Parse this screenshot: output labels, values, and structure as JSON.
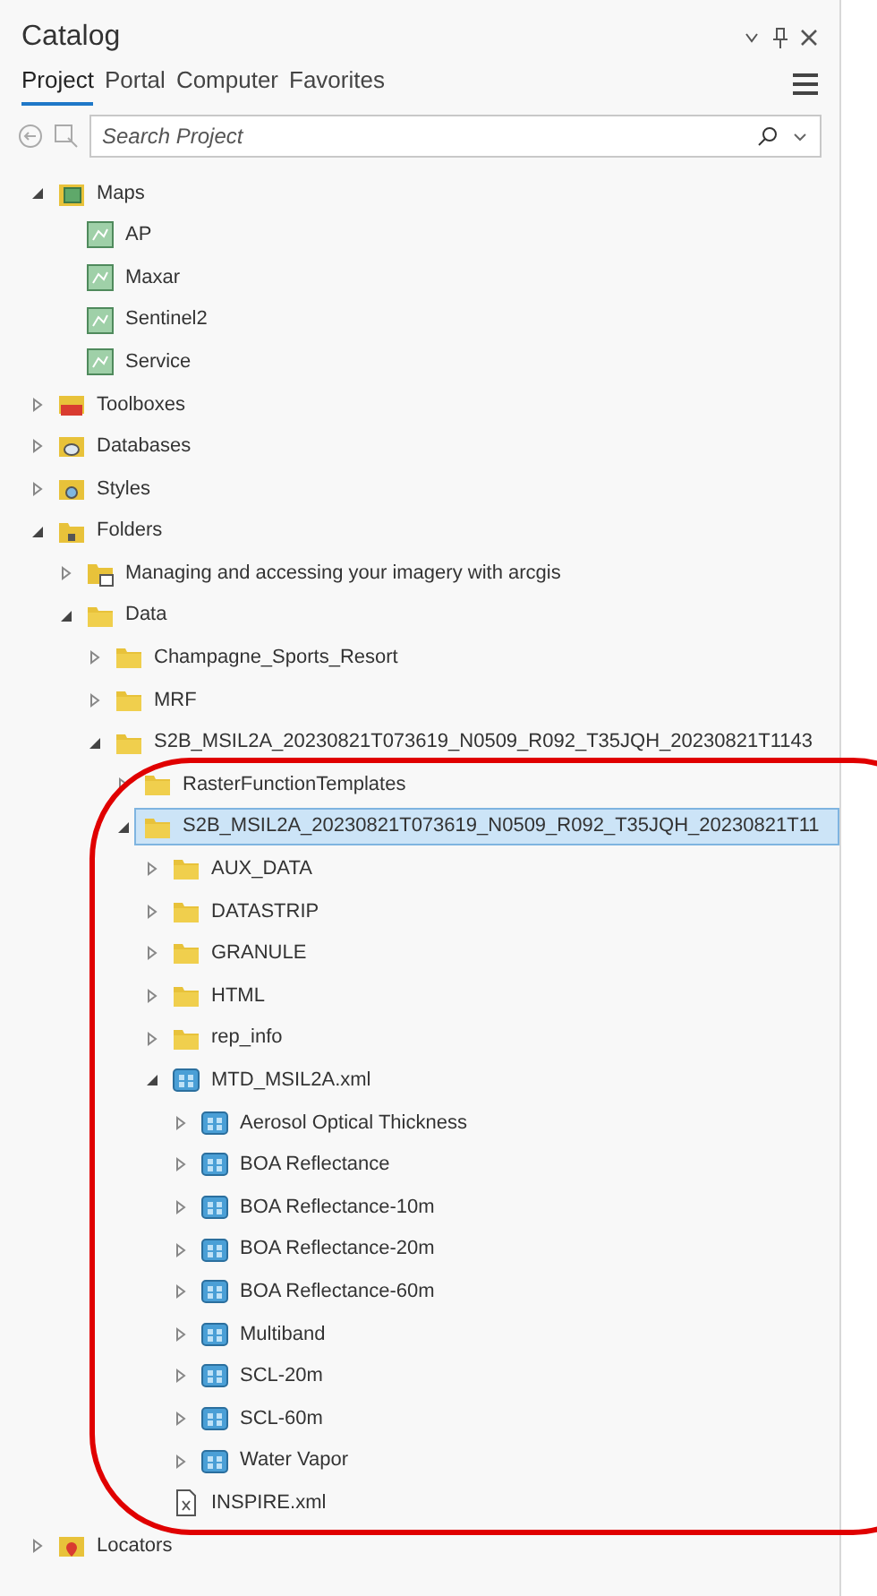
{
  "window": {
    "title": "Catalog"
  },
  "tabs": [
    {
      "label": "Project",
      "selected": true
    },
    {
      "label": "Portal",
      "selected": false
    },
    {
      "label": "Computer",
      "selected": false
    },
    {
      "label": "Favorites",
      "selected": false
    }
  ],
  "search": {
    "placeholder": "Search Project"
  },
  "tree": [
    {
      "label": "Maps",
      "kind": "maps",
      "expanded": true,
      "selected": false,
      "children": [
        {
          "label": "AP",
          "kind": "map",
          "selected": false
        },
        {
          "label": "Maxar",
          "kind": "map",
          "selected": false
        },
        {
          "label": "Sentinel2",
          "kind": "map",
          "selected": false
        },
        {
          "label": "Service",
          "kind": "map",
          "selected": false
        }
      ]
    },
    {
      "label": "Toolboxes",
      "kind": "toolboxes",
      "expanded": false,
      "selected": false
    },
    {
      "label": "Databases",
      "kind": "databases",
      "expanded": false,
      "selected": false
    },
    {
      "label": "Styles",
      "kind": "styles",
      "expanded": false,
      "selected": false
    },
    {
      "label": "Folders",
      "kind": "folders",
      "expanded": true,
      "selected": false,
      "children": [
        {
          "label": "Managing and accessing your imagery with arcgis",
          "kind": "folder-connection",
          "expanded": false,
          "selected": false
        },
        {
          "label": "Data",
          "kind": "folder",
          "expanded": true,
          "selected": false,
          "children": [
            {
              "label": "Champagne_Sports_Resort",
              "kind": "folder",
              "expanded": false,
              "selected": false
            },
            {
              "label": "MRF",
              "kind": "folder",
              "expanded": false,
              "selected": false
            },
            {
              "label": "S2B_MSIL2A_20230821T073619_N0509_R092_T35JQH_20230821T1143",
              "kind": "folder",
              "expanded": true,
              "selected": false,
              "children": [
                {
                  "label": "RasterFunctionTemplates",
                  "kind": "folder",
                  "expanded": false,
                  "selected": false
                },
                {
                  "label": "S2B_MSIL2A_20230821T073619_N0509_R092_T35JQH_20230821T11",
                  "kind": "folder",
                  "expanded": true,
                  "selected": true,
                  "children": [
                    {
                      "label": "AUX_DATA",
                      "kind": "folder",
                      "expanded": false,
                      "selected": false
                    },
                    {
                      "label": "DATASTRIP",
                      "kind": "folder",
                      "expanded": false,
                      "selected": false
                    },
                    {
                      "label": "GRANULE",
                      "kind": "folder",
                      "expanded": false,
                      "selected": false
                    },
                    {
                      "label": "HTML",
                      "kind": "folder",
                      "expanded": false,
                      "selected": false
                    },
                    {
                      "label": "rep_info",
                      "kind": "folder",
                      "expanded": false,
                      "selected": false
                    },
                    {
                      "label": "MTD_MSIL2A.xml",
                      "kind": "raster-product",
                      "expanded": true,
                      "selected": false,
                      "children": [
                        {
                          "label": "Aerosol Optical Thickness",
                          "kind": "raster",
                          "expanded": false,
                          "selected": false
                        },
                        {
                          "label": "BOA Reflectance",
                          "kind": "raster",
                          "expanded": false,
                          "selected": false
                        },
                        {
                          "label": "BOA Reflectance-10m",
                          "kind": "raster",
                          "expanded": false,
                          "selected": false
                        },
                        {
                          "label": "BOA Reflectance-20m",
                          "kind": "raster",
                          "expanded": false,
                          "selected": false
                        },
                        {
                          "label": "BOA Reflectance-60m",
                          "kind": "raster",
                          "expanded": false,
                          "selected": false
                        },
                        {
                          "label": "Multiband",
                          "kind": "raster",
                          "expanded": false,
                          "selected": false
                        },
                        {
                          "label": "SCL-20m",
                          "kind": "raster",
                          "expanded": false,
                          "selected": false
                        },
                        {
                          "label": "SCL-60m",
                          "kind": "raster",
                          "expanded": false,
                          "selected": false
                        },
                        {
                          "label": "Water Vapor",
                          "kind": "raster",
                          "expanded": false,
                          "selected": false
                        }
                      ]
                    },
                    {
                      "label": "INSPIRE.xml",
                      "kind": "file",
                      "selected": false
                    }
                  ]
                }
              ]
            }
          ]
        }
      ]
    },
    {
      "label": "Locators",
      "kind": "locators",
      "expanded": false,
      "selected": false
    }
  ]
}
